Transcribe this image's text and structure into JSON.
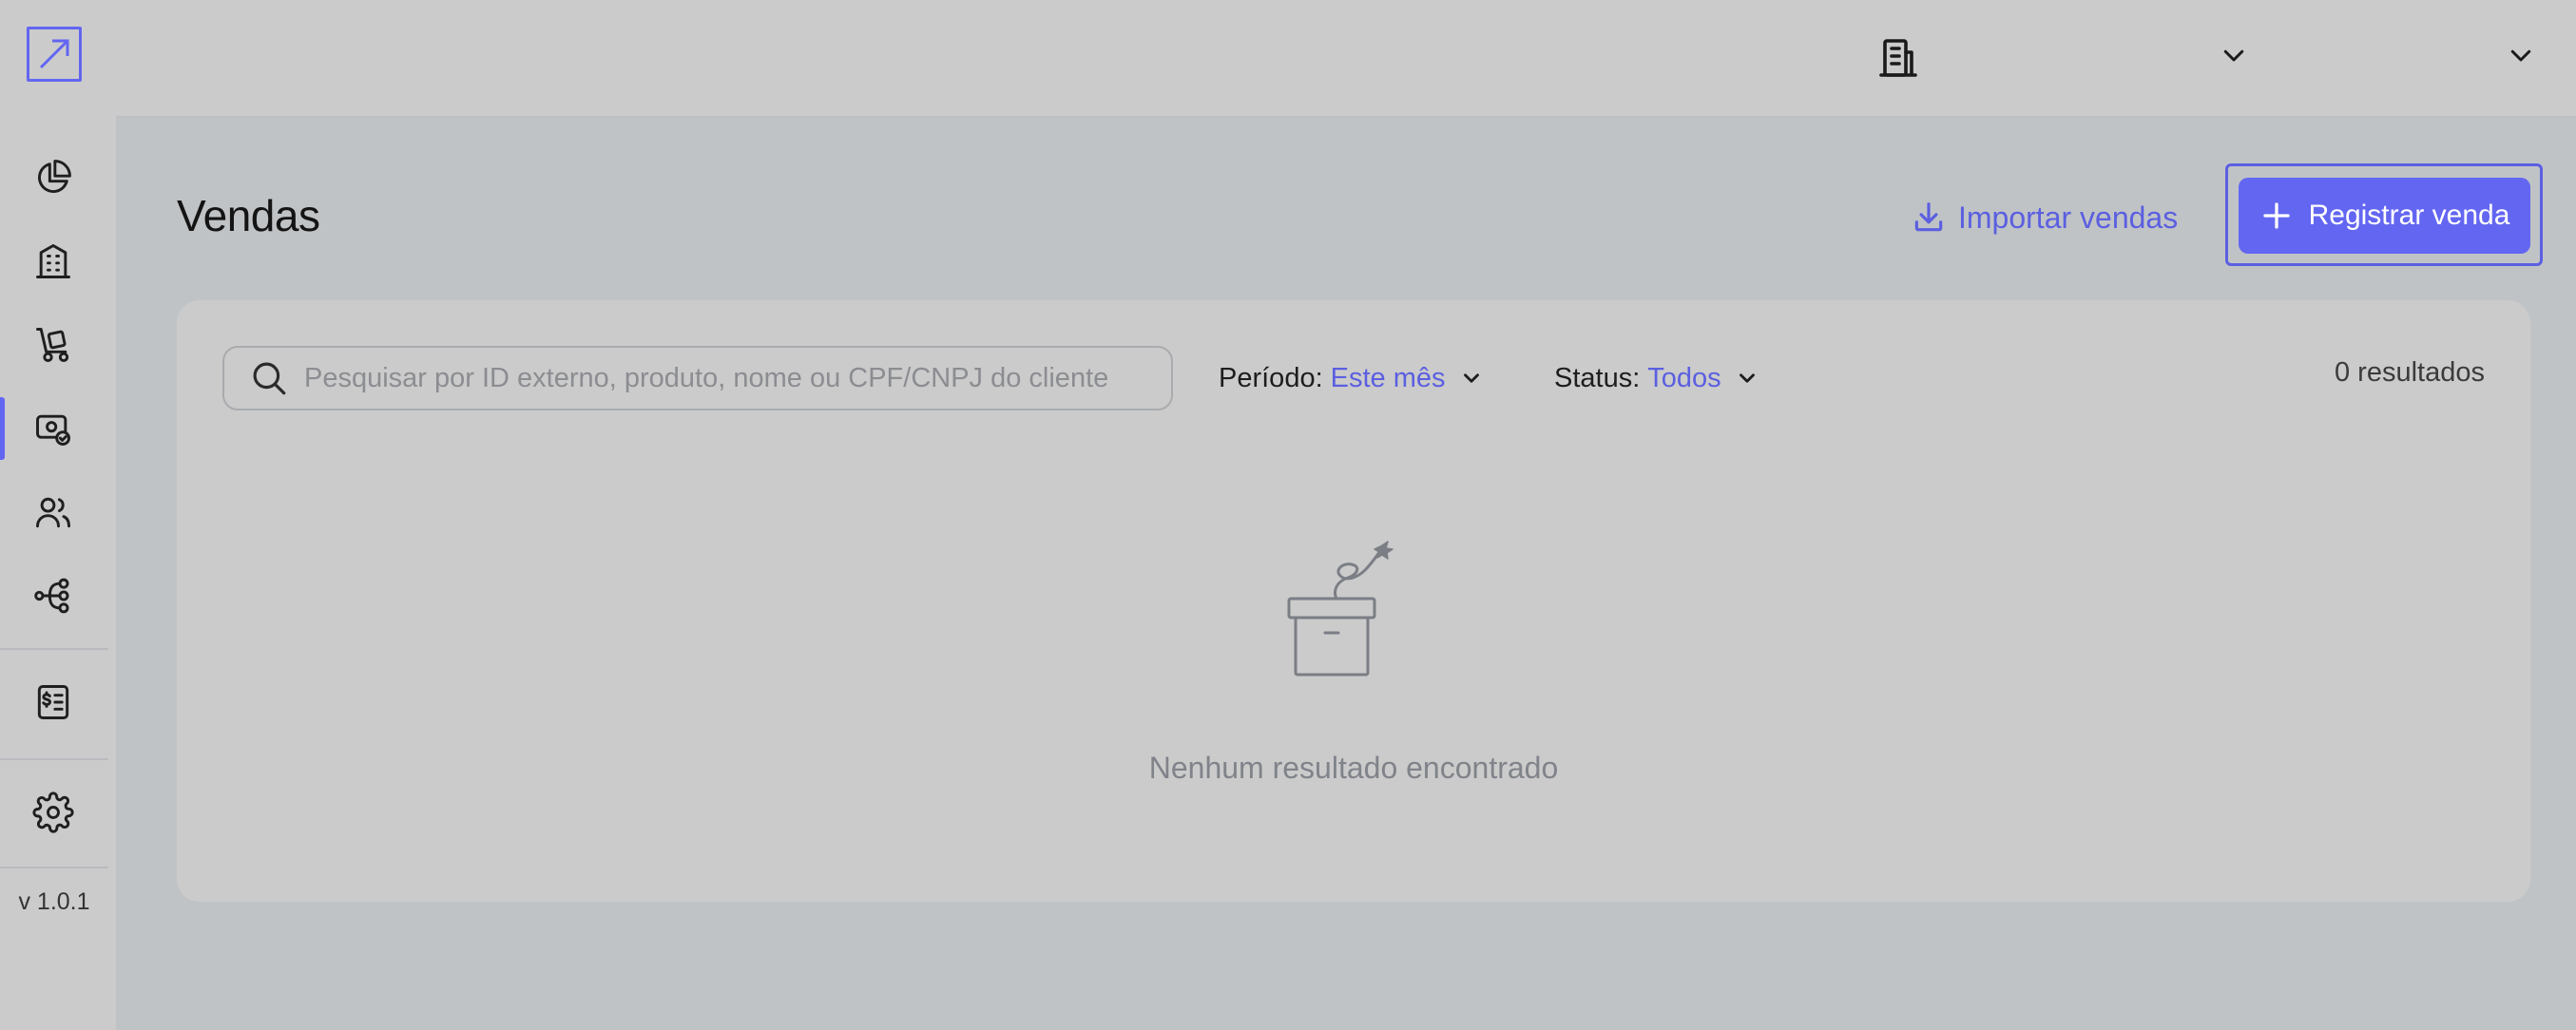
{
  "sidebar": {
    "logo_icon": "arrow-up-right-square-icon",
    "items": [
      {
        "name": "dashboard",
        "icon": "pie-chart-icon"
      },
      {
        "name": "companies",
        "icon": "building-icon"
      },
      {
        "name": "products",
        "icon": "hand-truck-icon"
      },
      {
        "name": "sales",
        "icon": "money-tag-icon",
        "active": true
      },
      {
        "name": "customers",
        "icon": "users-icon"
      },
      {
        "name": "integrations",
        "icon": "network-icon"
      },
      {
        "name": "billing",
        "icon": "invoice-icon"
      },
      {
        "name": "settings",
        "icon": "gear-icon"
      }
    ],
    "version": "v 1.0.1"
  },
  "topbar": {
    "company_icon": "building-icon",
    "company_dropdown_icon": "chevron-down-icon",
    "user_dropdown_icon": "chevron-down-icon"
  },
  "page": {
    "title": "Vendas",
    "import_label": "Importar vendas",
    "register_label": "Registrar venda"
  },
  "filters": {
    "search_placeholder": "Pesquisar por ID externo, produto, nome ou CPF/CNPJ do cliente",
    "search_value": "",
    "period_label": "Período:",
    "period_value": "Este mês",
    "status_label": "Status:",
    "status_value": "Todos",
    "results": "0 resultados"
  },
  "empty_state": {
    "icon": "empty-box-icon",
    "message": "Nenhum resultado encontrado"
  },
  "colors": {
    "accent": "#6366f1",
    "background": "#c0c3c6",
    "surface": "#cbcbcb"
  }
}
